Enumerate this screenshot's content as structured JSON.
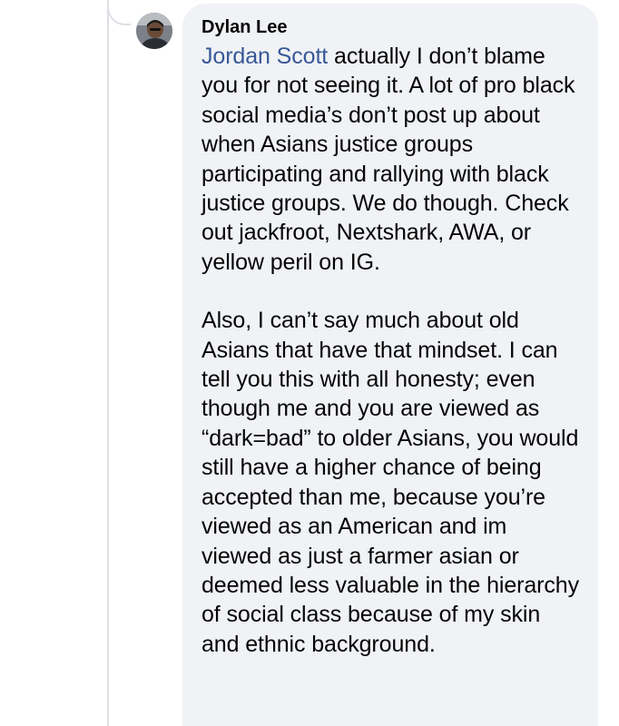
{
  "comment": {
    "author": "Dylan Lee",
    "mention": "Jordan Scott",
    "paragraph1_rest": " actually I don’t blame you for not seeing it. A lot of pro black social media’s don’t post up about when Asians justice groups participating and rallying with black justice groups. We do though. Check out jackfroot, Nextshark, AWA, or yellow peril on IG.",
    "paragraph2": "Also, I can’t say much about old Asians that have that mindset. I can tell you this with all honesty; even though me and you are viewed as “dark=bad” to older Asians, you would still have a higher chance of being accepted than me, because you’re viewed as an American and im viewed as just a farmer asian or deemed less valuable in the hierarchy of social class because of my skin and ethnic background."
  },
  "colors": {
    "bubble_background": "#f0f2f5",
    "mention_link": "#385898",
    "text": "#050505",
    "thread_line": "#dcdfe4"
  },
  "icons": {
    "avatar": "user-profile-photo"
  }
}
